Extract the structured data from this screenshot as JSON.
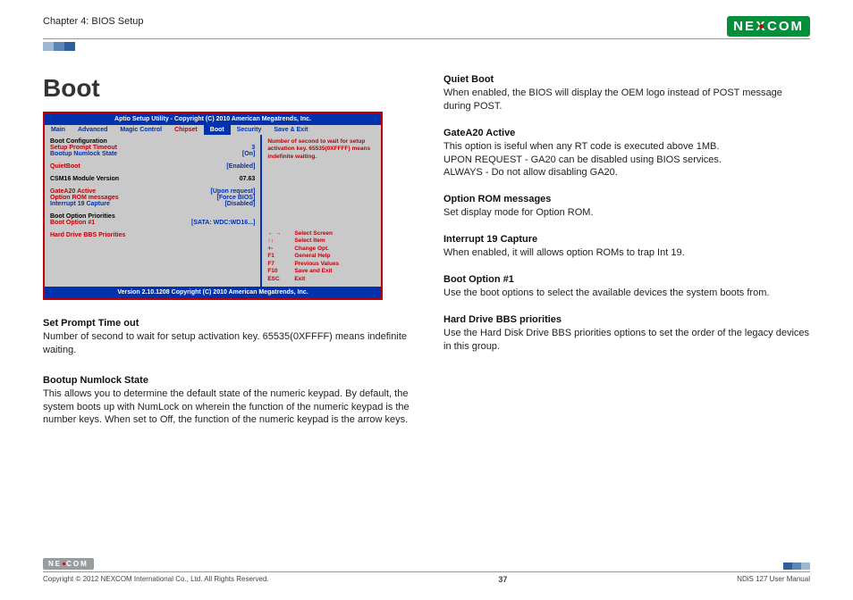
{
  "header": {
    "chapter": "Chapter 4: BIOS Setup",
    "logo_text": "NE COM",
    "logo_left": "NE",
    "logo_x": "X",
    "logo_right": "COM"
  },
  "title": "Boot",
  "bios": {
    "title": "Aptio  Setup  Utility - Copyright (C) 2010 American Megatrends, Inc.",
    "tabs": [
      "Main",
      "Advanced",
      "Magic Control",
      "Chipset",
      "Boot",
      "Security",
      "Save & Exit"
    ],
    "rows": [
      {
        "label": "Boot Configuration",
        "value": "",
        "lcls": "blk",
        "vcls": ""
      },
      {
        "label": "Setup Prompt Timeout",
        "value": "3",
        "lcls": "rd",
        "vcls": "bl"
      },
      {
        "label": "Bootup Numlock State",
        "value": "[On]",
        "lcls": "bl",
        "vcls": "bl"
      },
      {
        "label": "",
        "value": "",
        "lcls": "",
        "vcls": ""
      },
      {
        "label": "QuietBoot",
        "value": "[Enabled]",
        "lcls": "rd",
        "vcls": "bl"
      },
      {
        "label": "",
        "value": "",
        "lcls": "",
        "vcls": ""
      },
      {
        "label": "CSM16 Module Version",
        "value": "07.63",
        "lcls": "blk",
        "vcls": "blk"
      },
      {
        "label": "",
        "value": "",
        "lcls": "",
        "vcls": ""
      },
      {
        "label": "GateA20 Active",
        "value": "[Upon request]",
        "lcls": "rd",
        "vcls": "bl"
      },
      {
        "label": "Option ROM messages",
        "value": "[Force BIOS]",
        "lcls": "rd",
        "vcls": "bl"
      },
      {
        "label": "Interrupt 19 Capture",
        "value": "[Disabled]",
        "lcls": "bl",
        "vcls": "bl"
      },
      {
        "label": "",
        "value": "",
        "lcls": "",
        "vcls": ""
      },
      {
        "label": "Boot Option Priorities",
        "value": "",
        "lcls": "blk",
        "vcls": ""
      },
      {
        "label": "Boot Option #1",
        "value": "[SATA: WDC:WD16...]",
        "lcls": "rd",
        "vcls": "bl"
      },
      {
        "label": "",
        "value": "",
        "lcls": "",
        "vcls": ""
      },
      {
        "label": "Hard Drive BBS Priorities",
        "value": "",
        "lcls": "rd",
        "vcls": ""
      }
    ],
    "help_text": "Number of second to wait for setup activation key. 65535(0XFFFF) means indefinite waiting.",
    "keys": [
      {
        "k": "← →",
        "v": "Select Screen"
      },
      {
        "k": "↑↓",
        "v": "Select Item"
      },
      {
        "k": "+-",
        "v": "Change Opt."
      },
      {
        "k": "F1",
        "v": "General Help"
      },
      {
        "k": "F7",
        "v": "Previous Values"
      },
      {
        "k": "F10",
        "v": "Save and Exit"
      },
      {
        "k": "ESC",
        "v": "Exit"
      }
    ],
    "footer": "Version 2.10.1208 Copyright (C) 2010 American Megatrends, Inc."
  },
  "left_desc": [
    {
      "h": "Set Prompt Time out",
      "p": "Number of second to wait for setup activation key. 65535(0XFFFF) means indefinite waiting."
    },
    {
      "h": "Bootup Numlock State",
      "p": "This allows you to determine the default state of the numeric keypad. By default, the system boots up with NumLock on wherein the function of the numeric keypad is the number keys. When set to Off, the function of the numeric keypad is the arrow keys."
    }
  ],
  "right_desc": [
    {
      "h": "Quiet Boot",
      "p": "When enabled, the BIOS will display the OEM logo instead of POST message during POST."
    },
    {
      "h": "GateA20 Active",
      "p": "This option is iseful when any RT code is executed above 1MB.\nUPON REQUEST - GA20 can be disabled using BIOS services.\nALWAYS - Do not allow disabling GA20."
    },
    {
      "h": "Option ROM messages",
      "p": "Set display mode for Option ROM."
    },
    {
      "h": "Interrupt 19 Capture",
      "p": "When enabled, it will allows option ROMs to trap Int 19."
    },
    {
      "h": "Boot Option #1",
      "p": "Use the boot options to select the available devices the system boots from."
    },
    {
      "h": "Hard Drive BBS priorities",
      "p": "Use the Hard Disk Drive BBS priorities options to set the order  of the legacy devices in this group."
    }
  ],
  "footer": {
    "copyright": "Copyright © 2012 NEXCOM International Co., Ltd. All Rights Reserved.",
    "page": "37",
    "manual": "NDiS 127 User Manual"
  }
}
